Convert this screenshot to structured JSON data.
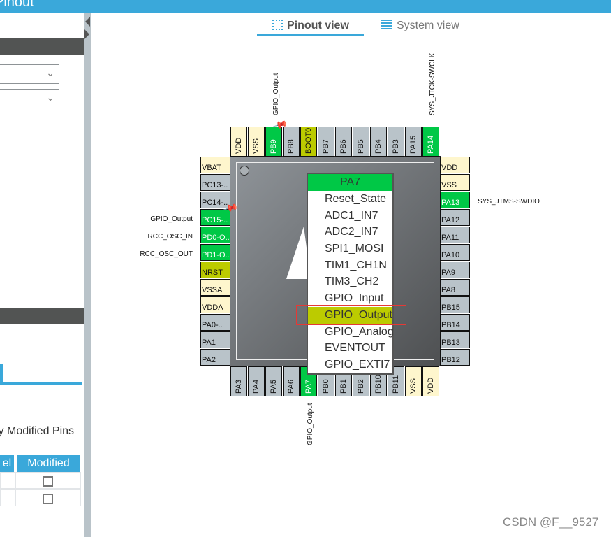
{
  "title": "Pinout",
  "left_panel": {
    "modified_text": "ly Modified Pins",
    "table_headers": [
      "el",
      "Modified"
    ],
    "rows": [
      {
        "modified": false
      },
      {
        "modified": false
      }
    ]
  },
  "view_tabs": [
    {
      "label": "Pinout view",
      "active": true,
      "icon": "chip-icon"
    },
    {
      "label": "System view",
      "active": false,
      "icon": "grid-list-icon"
    }
  ],
  "pins": {
    "top": [
      [
        "VDD",
        "pw"
      ],
      [
        "VSS",
        "pw"
      ],
      [
        "PB9",
        "gr"
      ],
      [
        "PB8",
        "io"
      ],
      [
        "BOOT0",
        "ol"
      ],
      [
        "PB7",
        "io"
      ],
      [
        "PB6",
        "io"
      ],
      [
        "PB5",
        "io"
      ],
      [
        "PB4",
        "io"
      ],
      [
        "PB3",
        "io"
      ],
      [
        "PA15",
        "io"
      ],
      [
        "PA14",
        "gr"
      ]
    ],
    "left": [
      [
        "VBAT",
        "pw"
      ],
      [
        "PC13-..",
        "io"
      ],
      [
        "PC14-..",
        "io"
      ],
      [
        "PC15-..",
        "gr"
      ],
      [
        "PD0-O..",
        "gr"
      ],
      [
        "PD1-O..",
        "gr"
      ],
      [
        "NRST",
        "ol"
      ],
      [
        "VSSA",
        "pw"
      ],
      [
        "VDDA",
        "pw"
      ],
      [
        "PA0-..",
        "io"
      ],
      [
        "PA1",
        "io"
      ],
      [
        "PA2",
        "io"
      ]
    ],
    "right": [
      [
        "VDD",
        "pw"
      ],
      [
        "VSS",
        "pw"
      ],
      [
        "PA13",
        "gr"
      ],
      [
        "PA12",
        "io"
      ],
      [
        "PA11",
        "io"
      ],
      [
        "PA10",
        "io"
      ],
      [
        "PA9",
        "io"
      ],
      [
        "PA8",
        "io"
      ],
      [
        "PB15",
        "io"
      ],
      [
        "PB14",
        "io"
      ],
      [
        "PB13",
        "io"
      ],
      [
        "PB12",
        "io"
      ]
    ],
    "bottom": [
      [
        "PA3",
        "io"
      ],
      [
        "PA4",
        "io"
      ],
      [
        "PA5",
        "io"
      ],
      [
        "PA6",
        "io"
      ],
      [
        "PA7",
        "gr"
      ],
      [
        "PB0",
        "io"
      ],
      [
        "PB1",
        "io"
      ],
      [
        "PB2",
        "io"
      ],
      [
        "PB10",
        "io"
      ],
      [
        "PB11",
        "io"
      ],
      [
        "VSS",
        "pw"
      ],
      [
        "VDD",
        "pw"
      ]
    ]
  },
  "signals": {
    "pb9": "GPIO_Output",
    "pa14": "SYS_JTCK-SWCLK",
    "pc15": "GPIO_Output",
    "pd0": "RCC_OSC_IN",
    "pd1": "RCC_OSC_OUT",
    "pa13": "SYS_JTMS-SWDIO",
    "pa7": "GPIO_Output"
  },
  "popup": {
    "pin": "PA7",
    "items": [
      "Reset_State",
      "ADC1_IN7",
      "ADC2_IN7",
      "SPI1_MOSI",
      "TIM1_CH1N",
      "TIM3_CH2",
      "GPIO_Input",
      "GPIO_Output",
      "GPIO_Analog",
      "EVENTOUT",
      "GPIO_EXTI7"
    ],
    "selected": "GPIO_Output"
  },
  "colors": {
    "accent": "#3aa8da",
    "pin_assigned": "#00c846",
    "pin_fixed": "#bccb00",
    "pin_power": "#fef6cd",
    "pin_free": "#b9c3c9",
    "highlight_box": "#e53935"
  },
  "watermark": "CSDN @F__9527"
}
